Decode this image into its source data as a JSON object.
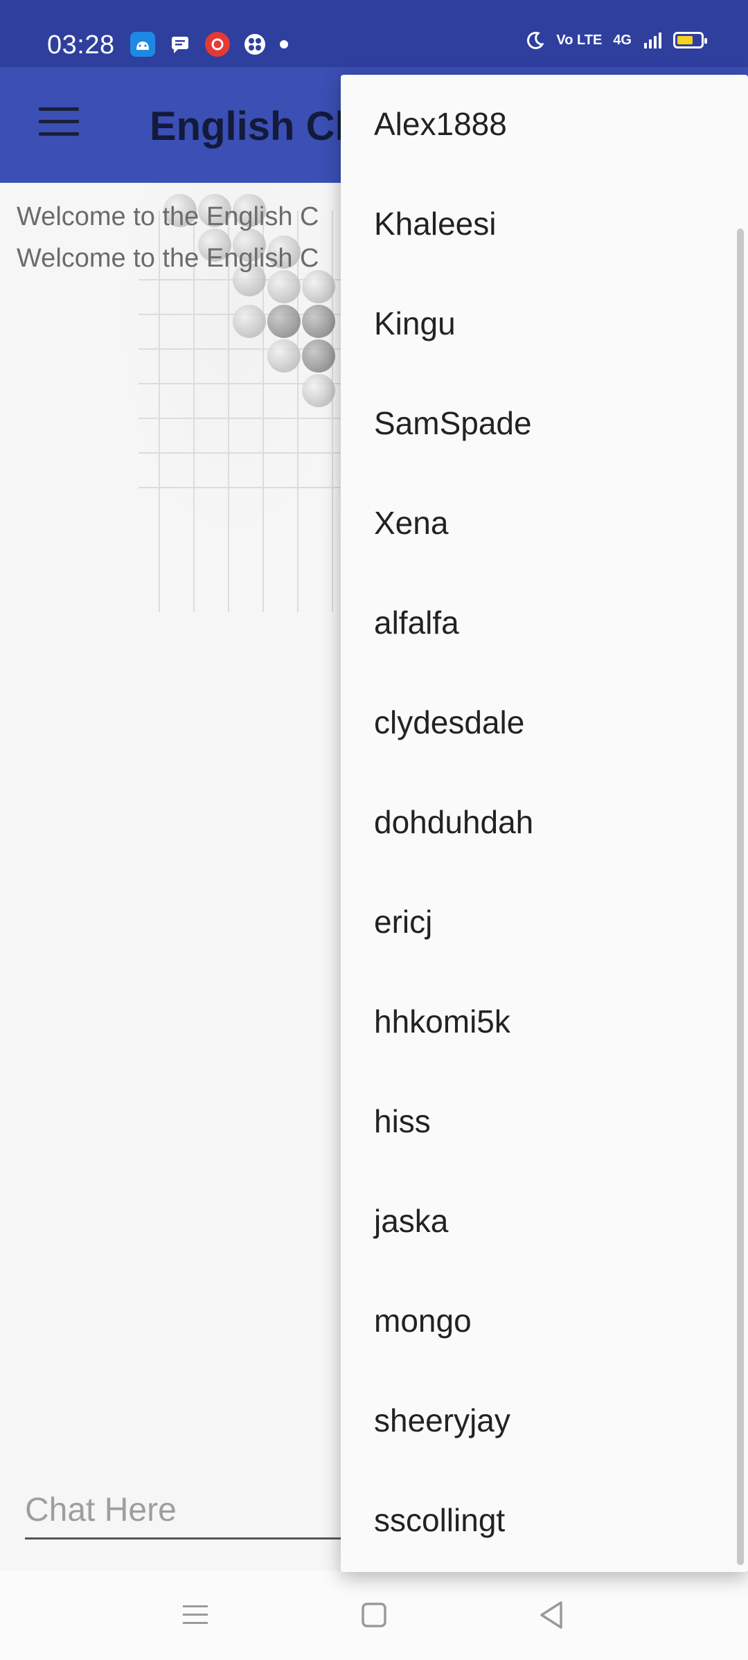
{
  "status_bar": {
    "time": "03:28",
    "network_text": "Vo LTE",
    "signal_text": "4G",
    "battery_level": 0.7,
    "colors": {
      "bar": "#2f3f9e",
      "battery": "#f7d11e"
    }
  },
  "toolbar": {
    "title": "English Ch",
    "menu_icon": "hamburger-menu-icon",
    "color": "#3b4fb4"
  },
  "messages": [
    "Welcome to the English C",
    "Welcome to the English C"
  ],
  "chat": {
    "placeholder": "Chat Here"
  },
  "user_menu": {
    "items": [
      "Alex1888",
      "Khaleesi",
      "Kingu",
      "SamSpade",
      "Xena",
      "alfalfa",
      "clydesdale",
      "dohduhdah",
      "ericj",
      "hhkomi5k",
      "hiss",
      "jaska",
      "mongo",
      "sheeryjay",
      "sscollingt"
    ]
  },
  "nav_bar": {
    "buttons": [
      "recents-icon",
      "home-icon",
      "back-icon"
    ]
  }
}
